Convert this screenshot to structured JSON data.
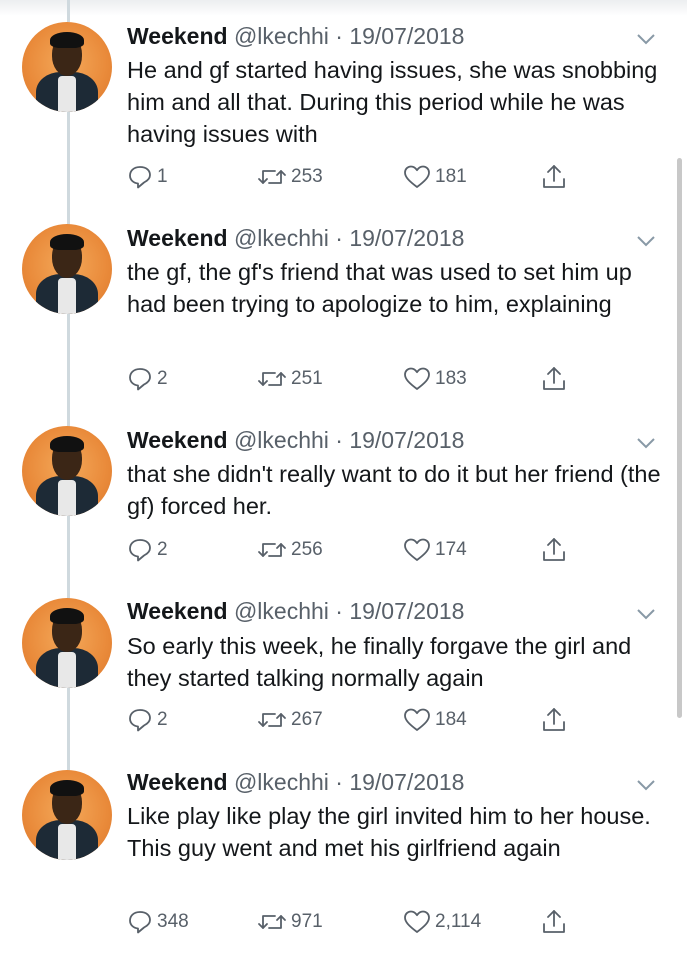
{
  "thread": {
    "tweets": [
      {
        "name": "Weekend",
        "meta": "@lkechhi · 19/07/2018",
        "text": "He and gf started having issues, she was snobbing him and all that. During this period while he was having issues with",
        "replies": "1",
        "retweets": "253",
        "likes": "181"
      },
      {
        "name": "Weekend",
        "meta": "@lkechhi · 19/07/2018",
        "text": "the gf, the gf's friend that was used to set him up had been trying to apologize to him, explaining",
        "replies": "2",
        "retweets": "251",
        "likes": "183"
      },
      {
        "name": "Weekend",
        "meta": "@lkechhi · 19/07/2018",
        "text": "that she didn't really want to do it but her friend (the gf) forced her.",
        "replies": "2",
        "retweets": "256",
        "likes": "174"
      },
      {
        "name": "Weekend",
        "meta": "@lkechhi · 19/07/2018",
        "text": "So early this week, he finally forgave the girl and they started talking normally again",
        "replies": "2",
        "retweets": "267",
        "likes": "184"
      },
      {
        "name": "Weekend",
        "meta": "@lkechhi · 19/07/2018",
        "text": "Like play like play the girl invited him to her house. This guy went and met his girlfriend again",
        "replies": "348",
        "retweets": "971",
        "likes": "2,114"
      }
    ]
  },
  "icons": {
    "reply": "reply-icon",
    "retweet": "retweet-icon",
    "like": "heart-icon",
    "share": "share-icon",
    "more": "chevron-down-icon"
  },
  "colors": {
    "text": "#14171a",
    "secondary": "#586069",
    "thread_line": "#cfd9de"
  }
}
